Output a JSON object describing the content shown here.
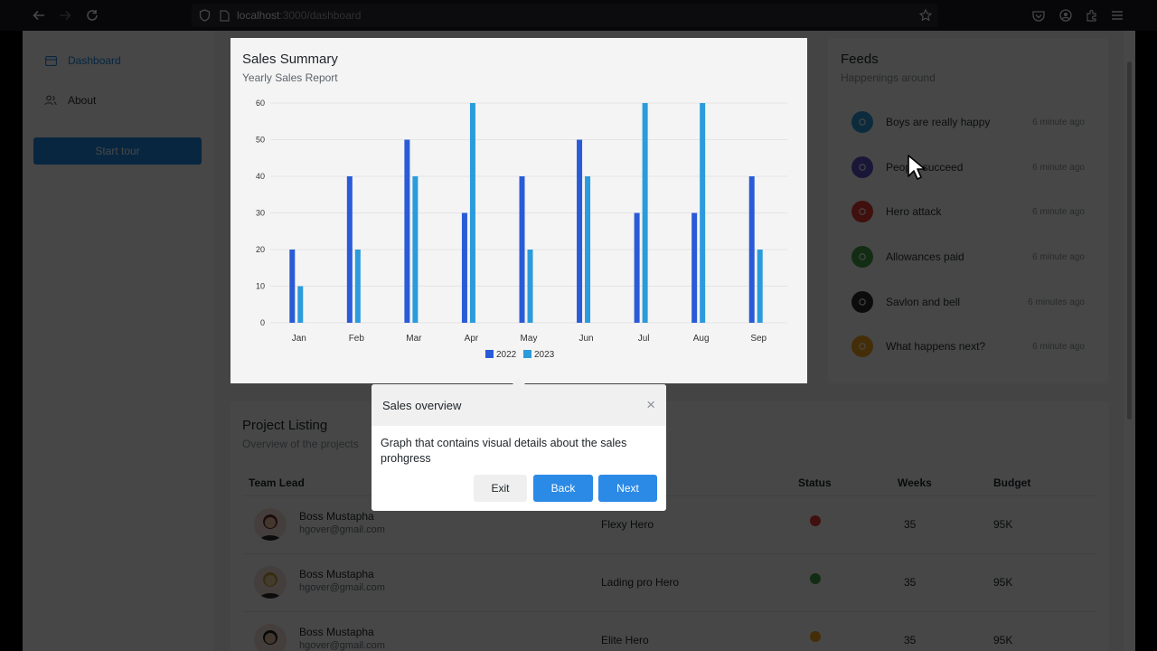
{
  "browser": {
    "url_host": "localhost",
    "url_path": ":3000/dashboard"
  },
  "sidebar": {
    "items": [
      {
        "label": "Dashboard",
        "icon": "dashboard-icon",
        "active": true
      },
      {
        "label": "About",
        "icon": "users-icon",
        "active": false
      }
    ],
    "start_tour_label": "Start tour"
  },
  "sales": {
    "title": "Sales Summary",
    "subtitle": "Yearly Sales Report"
  },
  "chart_data": {
    "type": "bar",
    "categories": [
      "Jan",
      "Feb",
      "Mar",
      "Apr",
      "May",
      "Jun",
      "Jul",
      "Aug",
      "Sep"
    ],
    "series": [
      {
        "name": "2022",
        "color": "#2a5bd7",
        "values": [
          20,
          40,
          50,
          30,
          40,
          50,
          30,
          30,
          40
        ]
      },
      {
        "name": "2023",
        "color": "#2b9bdc",
        "values": [
          10,
          20,
          40,
          60,
          20,
          40,
          60,
          60,
          20
        ]
      }
    ],
    "yticks": [
      0,
      10,
      20,
      30,
      40,
      50,
      60
    ],
    "ylim": [
      0,
      60
    ],
    "legend": "bottom",
    "grid": true
  },
  "feeds": {
    "title": "Feeds",
    "subtitle": "Happenings around",
    "items": [
      {
        "text": "Boys are really happy",
        "time": "6 minute ago",
        "color": "#2b9bdc",
        "icon": "bell-icon"
      },
      {
        "text": "People succeed",
        "time": "6 minute ago",
        "color": "#5e4fc9",
        "icon": "user-icon"
      },
      {
        "text": "Hero attack",
        "time": "6 minute ago",
        "color": "#e53935",
        "icon": "box-icon"
      },
      {
        "text": "Allowances paid",
        "time": "6 minute ago",
        "color": "#43a047",
        "icon": "calendar-icon"
      },
      {
        "text": "Savlon and bell",
        "time": "6 minutes ago",
        "color": "#2c2c2c",
        "icon": "bell-icon"
      },
      {
        "text": "What happens next?",
        "time": "6 minute ago",
        "color": "#f5a623",
        "icon": "tray-icon"
      }
    ]
  },
  "projects": {
    "title": "Project Listing",
    "subtitle": "Overview of the projects",
    "columns": {
      "lead": "Team Lead",
      "status": "Status",
      "weeks": "Weeks",
      "budget": "Budget"
    },
    "rows": [
      {
        "name": "Boss Mustapha",
        "email": "hgover@gmail.com",
        "project": "Flexy Hero",
        "status_color": "#e53935",
        "weeks": "35",
        "budget": "95K"
      },
      {
        "name": "Boss Mustapha",
        "email": "hgover@gmail.com",
        "project": "Lading pro Hero",
        "status_color": "#43a047",
        "weeks": "35",
        "budget": "95K"
      },
      {
        "name": "Boss Mustapha",
        "email": "hgover@gmail.com",
        "project": "Elite Hero",
        "status_color": "#f5a623",
        "weeks": "35",
        "budget": "95K"
      }
    ]
  },
  "tour": {
    "title": "Sales overview",
    "close_glyph": "×",
    "body": "Graph that contains visual details about the sales prohgress",
    "exit_label": "Exit",
    "back_label": "Back",
    "next_label": "Next"
  }
}
